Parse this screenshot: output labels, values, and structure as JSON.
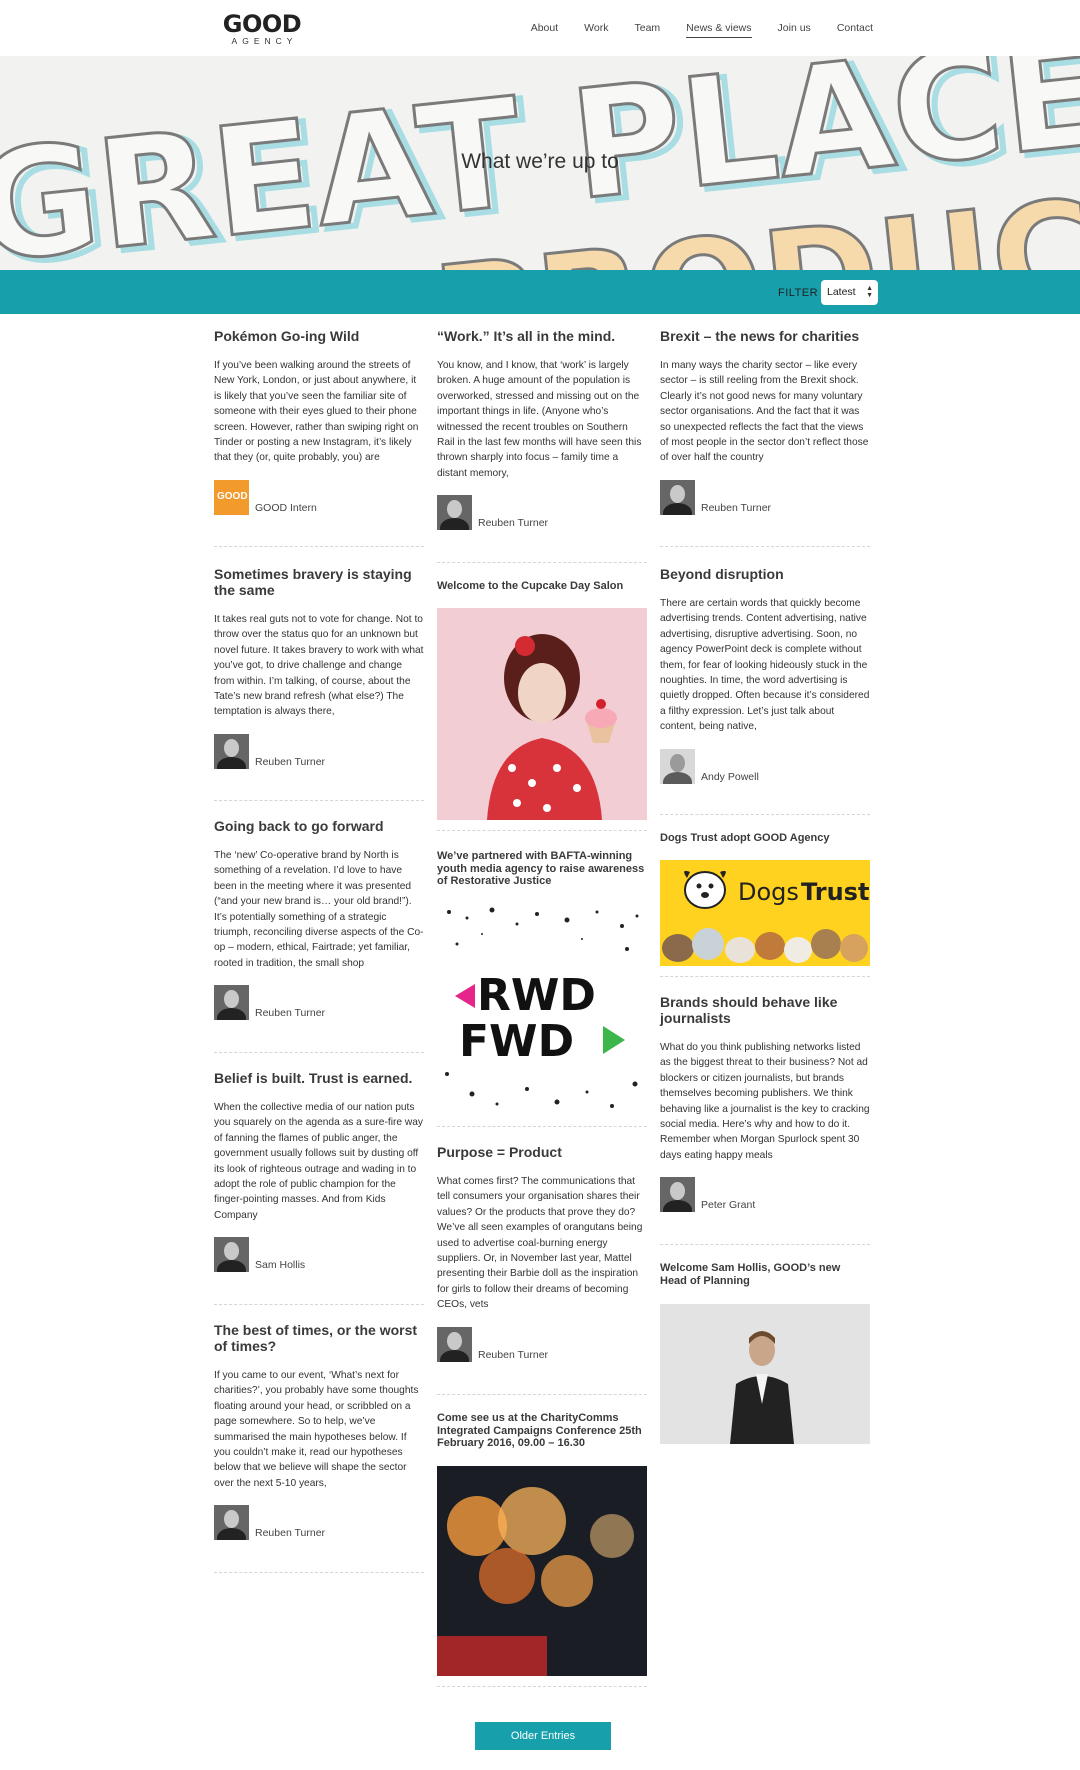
{
  "header": {
    "logo_main": "GOOD",
    "logo_sub": "AGENCY",
    "nav": [
      "About",
      "Work",
      "Team",
      "News & views",
      "Join us",
      "Contact"
    ],
    "active_nav": "News & views"
  },
  "hero": {
    "title": "What we’re up to",
    "background_text_1": "GREAT PLACES TO",
    "background_text_2": "PRODUCTS TO"
  },
  "filter": {
    "label": "FILTER",
    "selected": "Latest"
  },
  "col1": [
    {
      "title": "Pokémon Go-ing Wild",
      "excerpt": "If you’ve been walking around the streets of New York, London, or just about anywhere, it is likely that you’ve seen the familiar site of someone with their eyes glued to their phone screen. However, rather than swiping right on Tinder or posting a new Instagram, it’s likely that they (or, quite probably, you) are",
      "author": "GOOD Intern",
      "avatar_text": "GOOD"
    },
    {
      "title": "Sometimes bravery is staying the same",
      "excerpt": "It takes real guts not to vote for change. Not to throw over the status quo for an unknown but novel future. It takes bravery to work with what you’ve got, to drive challenge and change from within. I’m talking, of course, about the Tate’s new brand refresh (what else?) The temptation is always there,",
      "author": "Reuben Turner"
    },
    {
      "title": "Going back to go forward",
      "excerpt": "The ‘new’ Co-operative brand by North is something of a revelation. I’d love to have been in the meeting where it was presented (“and your new brand is… your old brand!”). It’s potentially something of a strategic triumph, reconciling diverse aspects of the Co-op – modern, ethical, Fairtrade; yet familiar, rooted in tradition, the small shop",
      "author": "Reuben Turner"
    },
    {
      "title": "Belief is built. Trust is earned.",
      "excerpt": "When the collective media of our nation puts you squarely on the agenda as a sure-fire way of fanning the flames of public anger, the government usually follows suit by dusting off its look of righteous outrage and wading in to adopt the role of public champion for the finger-pointing masses. And from Kids Company",
      "author": "Sam Hollis"
    },
    {
      "title": "The best of times, or the worst of times?",
      "excerpt": "If you came to our event, ‘What’s next for charities?’, you probably have some thoughts floating around your head, or scribbled on a page somewhere. So to help, we’ve summarised the main hypotheses below. If you couldn’t make it, read our hypotheses below that we believe will shape the sector over the next 5-10 years,",
      "author": "Reuben Turner"
    }
  ],
  "col2": [
    {
      "title": "“Work.” It’s all in the mind.",
      "excerpt": "You know, and I know, that ‘work’ is largely broken. A huge amount of the population is overworked, stressed and missing out on the important things in life. (Anyone who’s witnessed the recent troubles on Southern Rail in the last few months will have seen this thrown sharply into focus – family time a distant memory,",
      "author": "Reuben Turner"
    },
    {
      "title": "Welcome to the Cupcake Day Salon"
    },
    {
      "title": "We’ve partnered with BAFTA-winning youth media agency to raise awareness of Restorative Justice",
      "image_text_1": "RWD",
      "image_text_2": "FWD"
    },
    {
      "title": "Purpose = Product",
      "excerpt": "What comes first? The communications that tell consumers your organisation shares their values? Or the products that prove they do? We’ve all seen examples of orangutans being used to advertise coal-burning energy suppliers. Or, in November last year, Mattel presenting their Barbie doll as the inspiration for girls to follow their dreams of becoming CEOs, vets",
      "author": "Reuben Turner"
    },
    {
      "title": "Come see us at the CharityComms Integrated Campaigns Conference 25th February 2016, 09.00 – 16.30"
    }
  ],
  "col3": [
    {
      "title": "Brexit – the news for charities",
      "excerpt": "In many ways the charity sector – like every sector – is still reeling from the Brexit shock. Clearly it’s not good news for many voluntary sector organisations. And the fact that it was so unexpected reflects the fact that the views of most people in the sector don’t reflect those of over half the country",
      "author": "Reuben Turner"
    },
    {
      "title": "Beyond disruption",
      "excerpt": "There are certain words that quickly become advertising trends. Content advertising, native advertising, disruptive advertising. Soon, no agency PowerPoint deck is complete without them, for fear of looking hideously stuck in the noughties. In time, the word advertising is quietly dropped. Often because it’s considered a filthy expression. Let’s just talk about content, being native,",
      "author": "Andy Powell"
    },
    {
      "title": "Dogs Trust adopt GOOD Agency",
      "image_text_1": "Dogs",
      "image_text_2": "Trust"
    },
    {
      "title": "Brands should behave like journalists",
      "excerpt": "What do you think publishing networks listed as the biggest threat to their business? Not ad blockers or citizen journalists, but brands themselves becoming publishers. We think behaving like a journalist is the key to cracking social media. Here’s why and how to do it. Remember when Morgan Spurlock spent 30 days eating happy meals",
      "author": "Peter Grant"
    },
    {
      "title": "Welcome Sam Hollis, GOOD’s new Head of Planning"
    }
  ],
  "pagination": {
    "older_label": "Older Entries"
  },
  "colors": {
    "accent": "#17a0ac",
    "text": "#333333"
  }
}
